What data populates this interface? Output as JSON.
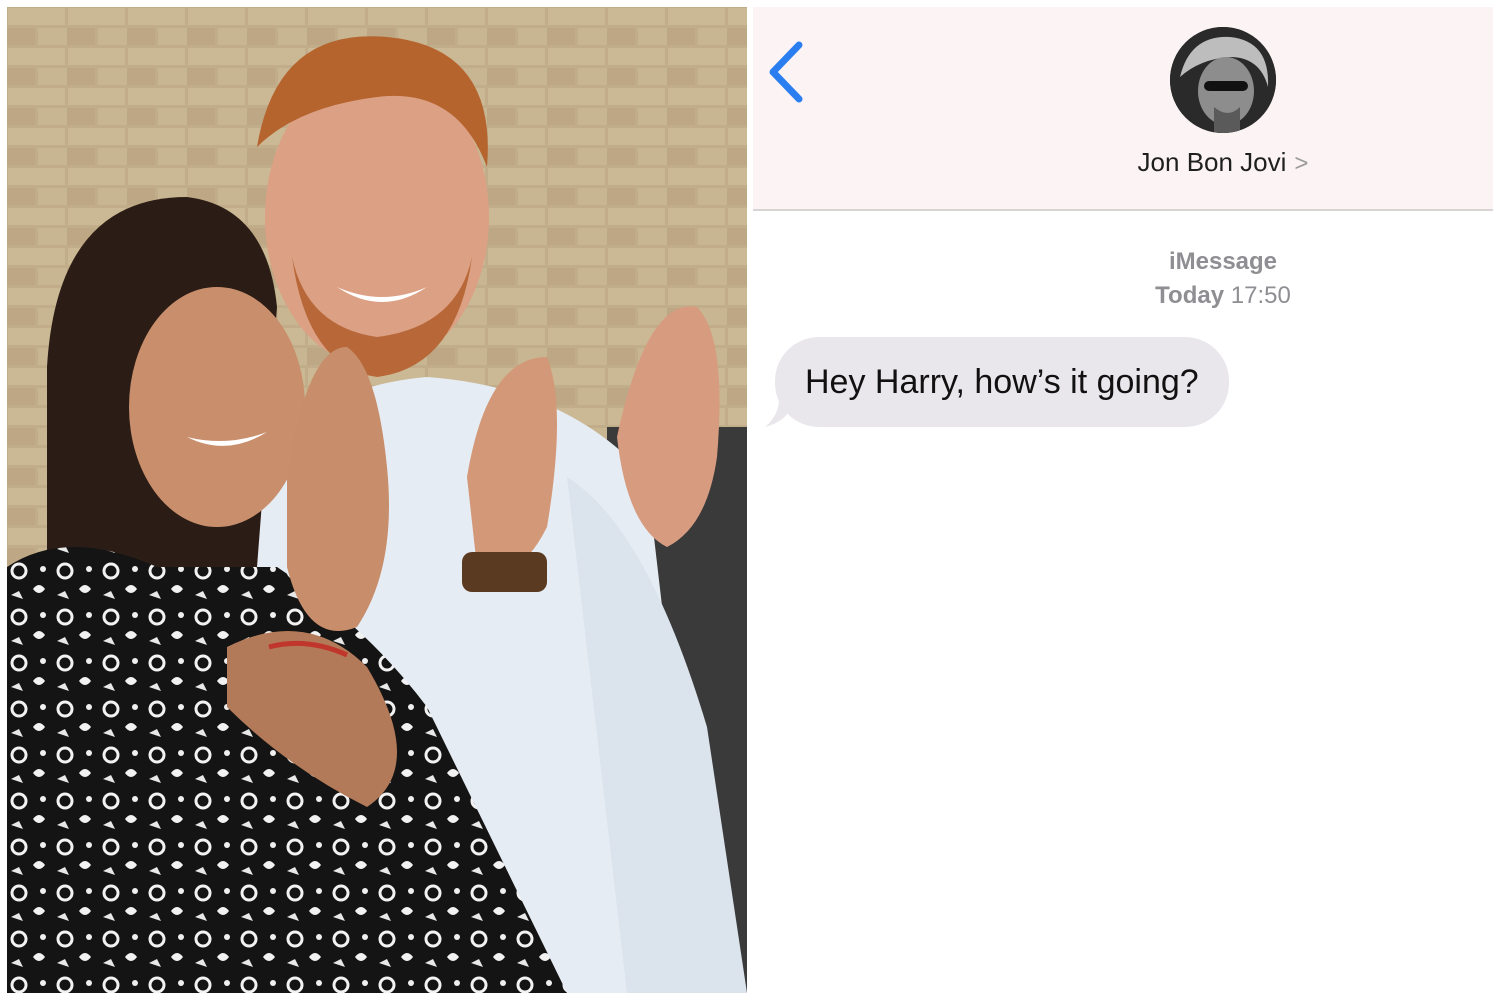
{
  "photo": {
    "description_icon": "couple-clapping-photo"
  },
  "conversation": {
    "back_icon": "chevron-left-icon",
    "contact": {
      "name": "Jon Bon Jovi",
      "chevron": ">",
      "avatar_icon": "contact-avatar-photo"
    },
    "service_label": "iMessage",
    "timestamp": {
      "day": "Today",
      "time": "17:50"
    },
    "messages": [
      {
        "direction": "incoming",
        "text": "Hey Harry, how’s it going?"
      }
    ]
  },
  "colors": {
    "accent": "#2a7ef0",
    "header_bg": "#fcf4f4",
    "bubble_incoming": "#e9e7ec",
    "meta_text": "#8e8e93"
  }
}
